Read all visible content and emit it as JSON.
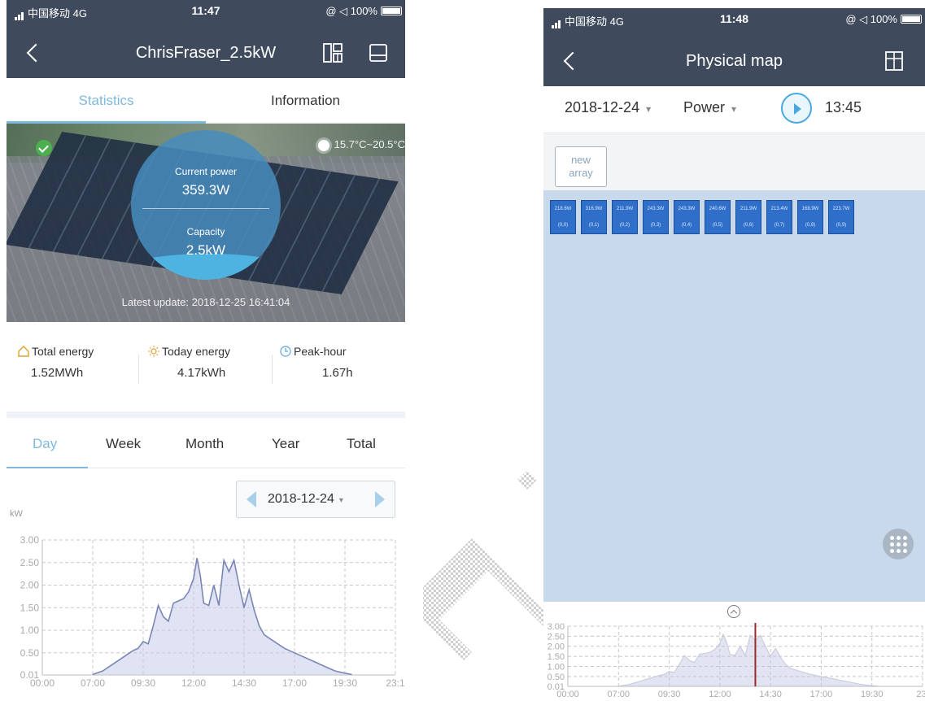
{
  "left": {
    "status": {
      "carrier": "中国移动 4G",
      "time": "11:47",
      "right": "@ ◁ 100%"
    },
    "title": "ChrisFraser_2.5kW",
    "tabs": [
      {
        "label": "Statistics"
      },
      {
        "label": "Information"
      }
    ],
    "hero": {
      "weather": "15.7°C~20.5°C",
      "current_power_label": "Current power",
      "current_power_value": "359.3W",
      "capacity_label": "Capacity",
      "capacity_value": "2.5kW",
      "latest_update": "Latest update: 2018-12-25 16:41:04"
    },
    "stats": [
      {
        "label": "Total energy",
        "value": "1.52MWh"
      },
      {
        "label": "Today energy",
        "value": "4.17kWh"
      },
      {
        "label": "Peak-hour",
        "value": "1.67h"
      }
    ],
    "periods": [
      {
        "label": "Day"
      },
      {
        "label": "Week"
      },
      {
        "label": "Month"
      },
      {
        "label": "Year"
      },
      {
        "label": "Total"
      }
    ],
    "date": "2018-12-24",
    "unit": "kW",
    "chart_data": {
      "type": "area",
      "ylabel": "kW",
      "ylim": [
        0.01,
        3.0
      ],
      "yticks": [
        "3.00",
        "2.50",
        "2.00",
        "1.50",
        "1.00",
        "0.50",
        "0.01"
      ],
      "xticks": [
        "00:00",
        "07:00",
        "09:30",
        "12:00",
        "14:30",
        "17:00",
        "19:30",
        "23:1"
      ],
      "x": [
        "07:00",
        "07:30",
        "08:00",
        "08:30",
        "09:00",
        "09:15",
        "09:30",
        "09:45",
        "10:00",
        "10:15",
        "10:30",
        "10:45",
        "11:00",
        "11:15",
        "11:30",
        "11:45",
        "12:00",
        "12:10",
        "12:20",
        "12:30",
        "12:45",
        "13:00",
        "13:15",
        "13:30",
        "13:45",
        "14:00",
        "14:15",
        "14:30",
        "14:45",
        "15:00",
        "15:15",
        "15:30",
        "16:00",
        "16:30",
        "17:00",
        "17:30",
        "18:00",
        "18:30",
        "19:00",
        "19:30",
        "20:00"
      ],
      "values": [
        0.02,
        0.1,
        0.25,
        0.4,
        0.55,
        0.6,
        0.75,
        0.7,
        1.1,
        1.55,
        1.3,
        1.2,
        1.6,
        1.65,
        1.7,
        1.85,
        2.15,
        2.6,
        2.2,
        1.6,
        1.55,
        2.0,
        1.55,
        2.55,
        2.3,
        2.55,
        2.0,
        1.5,
        1.9,
        1.45,
        1.1,
        0.9,
        0.75,
        0.6,
        0.5,
        0.4,
        0.3,
        0.2,
        0.1,
        0.05,
        0.02
      ]
    }
  },
  "right": {
    "status": {
      "carrier": "中国移动 4G",
      "time": "11:48",
      "right": "@ ◁ 100%"
    },
    "title": "Physical map",
    "toolbar": {
      "date": "2018-12-24",
      "metric": "Power",
      "time": "13:45"
    },
    "new_array": "new\narray",
    "panels": [
      {
        "power": "218.6W",
        "pos": "(0,0)"
      },
      {
        "power": "316.9W",
        "pos": "(0,1)"
      },
      {
        "power": "211.9W",
        "pos": "(0,2)"
      },
      {
        "power": "243.3W",
        "pos": "(0,3)"
      },
      {
        "power": "243.3W",
        "pos": "(0,4)"
      },
      {
        "power": "240.6W",
        "pos": "(0,5)"
      },
      {
        "power": "211.9W",
        "pos": "(0,6)"
      },
      {
        "power": "213.4W",
        "pos": "(0,7)"
      },
      {
        "power": "168.9W",
        "pos": "(0,8)"
      },
      {
        "power": "223.7W",
        "pos": "(0,9)"
      }
    ],
    "chart_data": {
      "type": "area",
      "yticks": [
        "3.00",
        "2.50",
        "2.00",
        "1.50",
        "1.00",
        "0.50",
        "0.01"
      ],
      "xticks": [
        "00:00",
        "07:00",
        "09:30",
        "12:00",
        "14:30",
        "17:00",
        "19:30",
        "23:"
      ],
      "marker_time": "13:45"
    }
  },
  "colors": {
    "header": "#3f4b5d",
    "accent": "#7fb9dc",
    "panel": "#2f6fc9",
    "map_bg": "#c9d9ec"
  }
}
